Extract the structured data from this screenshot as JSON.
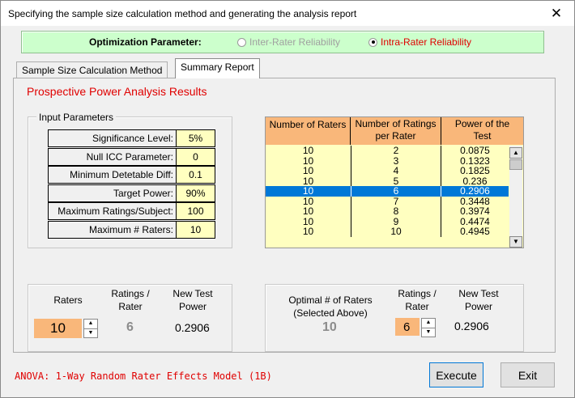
{
  "window": {
    "title": "Specifying the sample size calculation method and generating the analysis report",
    "close_glyph": "✕"
  },
  "optimization": {
    "label": "Optimization Parameter:",
    "options": [
      {
        "label": "Inter-Rater Reliability",
        "selected": false,
        "enabled": false
      },
      {
        "label": "Intra-Rater Reliability",
        "selected": true,
        "enabled": true
      }
    ]
  },
  "tabs": [
    {
      "label": "Sample Size Calculation Method",
      "active": false
    },
    {
      "label": "Summary Report",
      "active": true
    }
  ],
  "report": {
    "heading": "Prospective Power Analysis Results",
    "input_parameters": {
      "title": "Input Parameters",
      "rows": [
        {
          "label": "Significance Level:",
          "value": "5%"
        },
        {
          "label": "Null ICC Parameter:",
          "value": "0"
        },
        {
          "label": "Minimum Detetable Diff:",
          "value": "0.1"
        },
        {
          "label": "Target Power:",
          "value": "90%"
        },
        {
          "label": "Maximum Ratings/Subject:",
          "value": "100"
        },
        {
          "label": "Maximum # Raters:",
          "value": "10"
        }
      ]
    },
    "results_table": {
      "headers": [
        "Number of Raters",
        "Number of Ratings per Rater",
        "Power of the Test"
      ],
      "header_lines": [
        [
          "Number of Raters"
        ],
        [
          "Number of Ratings",
          "per Rater"
        ],
        [
          "Power of the",
          "Test"
        ]
      ],
      "rows": [
        [
          "10",
          "2",
          "0.0875"
        ],
        [
          "10",
          "3",
          "0.1323"
        ],
        [
          "10",
          "4",
          "0.1825"
        ],
        [
          "10",
          "5",
          "0.236"
        ],
        [
          "10",
          "6",
          "0.2906"
        ],
        [
          "10",
          "7",
          "0.3448"
        ],
        [
          "10",
          "8",
          "0.3974"
        ],
        [
          "10",
          "9",
          "0.4474"
        ],
        [
          "10",
          "10",
          "0.4945"
        ]
      ],
      "selected_row": 4,
      "scroll_up": "▲",
      "scroll_down": "▼"
    },
    "left_summary": {
      "raters_label": "Raters",
      "raters_value": "10",
      "ratings_label": [
        "Ratings /",
        "Rater"
      ],
      "ratings_value": "6",
      "power_label": [
        "New Test",
        "Power"
      ],
      "power_value": "0.2906"
    },
    "right_summary": {
      "optimal_label": [
        "Optimal # of Raters",
        "(Selected Above)"
      ],
      "optimal_value": "10",
      "ratings_label": [
        "Ratings /",
        "Rater"
      ],
      "ratings_value": "6",
      "power_label": [
        "New Test",
        "Power"
      ],
      "power_value": "0.2906"
    },
    "spin_up": "▲",
    "spin_down": "▼"
  },
  "footer": {
    "model": "ANOVA: 1-Way Random Rater Effects Model (1B)",
    "execute_label": "Execute",
    "exit_label": "Exit"
  },
  "colors": {
    "accent_red": "#e00000",
    "header_orange": "#f9b77a",
    "cell_yellow": "#ffffc0",
    "green_bar": "#ccffcc",
    "select_blue": "#0078d7"
  }
}
